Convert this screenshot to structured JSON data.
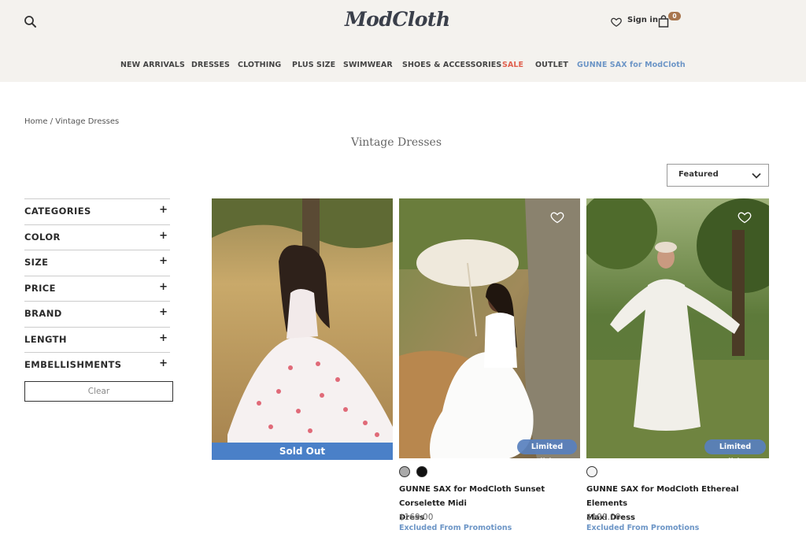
{
  "header": {
    "logo": "ModCloth",
    "sign_in": "Sign in",
    "bag_count": "0",
    "icons": [
      "search-icon",
      "heart-icon",
      "bag-icon"
    ]
  },
  "nav": {
    "items": [
      {
        "label": "NEW ARRIVALS"
      },
      {
        "label": "DRESSES"
      },
      {
        "label": "CLOTHING"
      },
      {
        "label": "PLUS SIZE"
      },
      {
        "label": "SWIMWEAR"
      },
      {
        "label": "SHOES & ACCESSORIES"
      },
      {
        "label": "SALE"
      },
      {
        "label": "OUTLET"
      },
      {
        "label": "GUNNE SAX for ModCloth"
      }
    ]
  },
  "breadcrumb": {
    "home": "Home",
    "separator": " / ",
    "current": "Vintage Dresses"
  },
  "page_title": "Vintage Dresses",
  "sort": {
    "selected": "Featured"
  },
  "filters": {
    "items": [
      {
        "label": "CATEGORIES",
        "toggle": "+"
      },
      {
        "label": "COLOR",
        "toggle": "+"
      },
      {
        "label": "SIZE",
        "toggle": "+"
      },
      {
        "label": "PRICE",
        "toggle": "+"
      },
      {
        "label": "BRAND",
        "toggle": "+"
      },
      {
        "label": "LENGTH",
        "toggle": "+"
      },
      {
        "label": "EMBELLISHMENTS",
        "toggle": "+"
      }
    ],
    "clear_label": "Clear"
  },
  "products": [
    {
      "status": "Sold Out"
    },
    {
      "badge": "Limited Edition",
      "swatches": [
        "#aaaaaa",
        "#111111"
      ],
      "name_line1": "GUNNE SAX for ModCloth Sunset Corselette Midi",
      "name_line2": "Dress",
      "price": "$169.00",
      "promo": "Excluded From Promotions"
    },
    {
      "badge": "Limited Edition",
      "swatches": [
        "#f4f4f4"
      ],
      "name_line1": "GUNNE SAX for ModCloth Ethereal Elements",
      "name_line2": "Maxi Dress",
      "price": "$199.00",
      "promo": "Excluded From Promotions"
    }
  ],
  "colors": {
    "header_bg": "#f4f2ee",
    "sale": "#e0614f",
    "accent_blue": "#6c95c6",
    "badge_blue": "#4a80c8",
    "bag_badge": "#a8764e"
  }
}
